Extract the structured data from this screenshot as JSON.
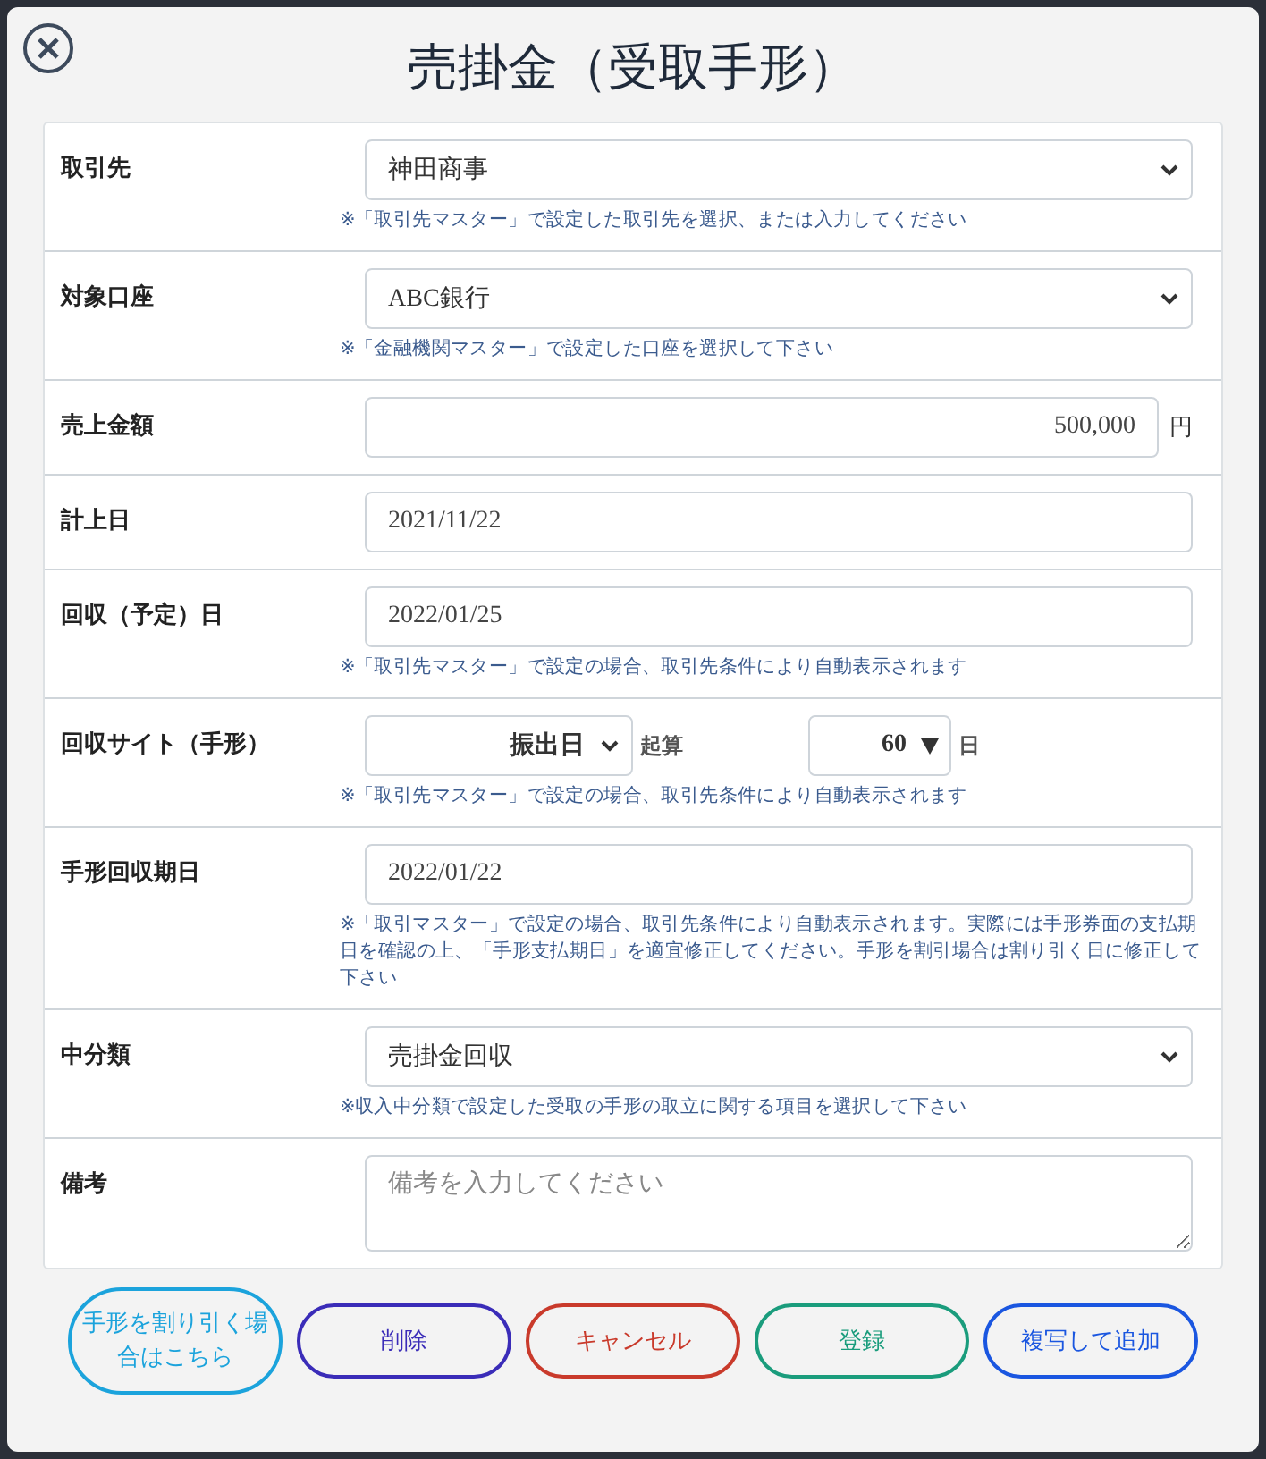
{
  "dialog": {
    "title": "売掛金（受取手形）"
  },
  "fields": [
    {
      "kind": "select",
      "label": "取引先",
      "value": "神田商事",
      "note": "※「取引先マスター」で設定した取引先を選択、または入力してください"
    },
    {
      "kind": "select",
      "label": "対象口座",
      "value": "ABC銀行",
      "note": "※「金融機関マスター」で設定した口座を選択して下さい"
    },
    {
      "kind": "amount",
      "label": "売上金額",
      "value": "500,000",
      "unit": "円"
    },
    {
      "kind": "input",
      "label": "計上日",
      "value": "2021/11/22"
    },
    {
      "kind": "input",
      "label": "回収（予定）日",
      "value": "2022/01/25",
      "note": "※「取引先マスター」で設定の場合、取引先条件により自動表示されます"
    },
    {
      "kind": "site",
      "label": "回収サイト（手形）",
      "base": "振出日",
      "base_suffix": "起算",
      "days": "60",
      "days_suffix": "日",
      "note": "※「取引先マスター」で設定の場合、取引先条件により自動表示されます"
    },
    {
      "kind": "input",
      "label": "手形回収期日",
      "value": "2022/01/22",
      "note": "※「取引マスター」で設定の場合、取引先条件により自動表示されます。実際には手形券面の支払期日を確認の上、「手形支払期日」を適宜修正してください。手形を割引場合は割り引く日に修正して下さい"
    },
    {
      "kind": "select",
      "label": "中分類",
      "value": "売掛金回収",
      "note": "※収入中分類で設定した受取の手形の取立に関する項目を選択して下さい"
    },
    {
      "kind": "textarea",
      "label": "備考",
      "placeholder": "備考を入力してください"
    }
  ],
  "buttons": [
    {
      "label": "手形を割り引く場合はこちら",
      "color": "#1ba3dc"
    },
    {
      "label": "削除",
      "color": "#3a2cb8"
    },
    {
      "label": "キャンセル",
      "color": "#c93a2b"
    },
    {
      "label": "登録",
      "color": "#1a9c7c"
    },
    {
      "label": "複写して追加",
      "color": "#1a56e0"
    }
  ]
}
